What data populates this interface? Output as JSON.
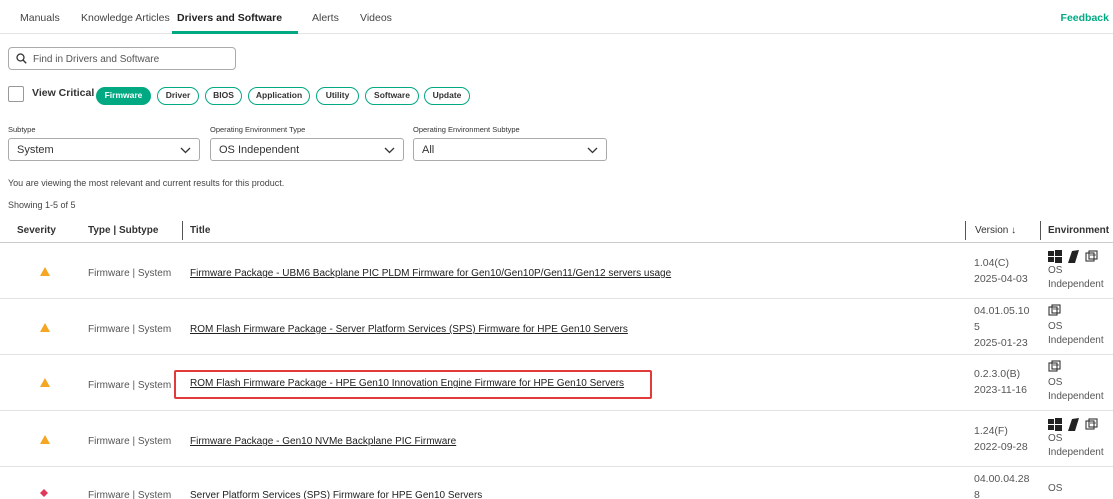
{
  "tabs": [
    {
      "label": "Manuals"
    },
    {
      "label": "Knowledge Articles"
    },
    {
      "label": "Drivers and Software",
      "active": true
    },
    {
      "label": "Alerts"
    },
    {
      "label": "Videos"
    }
  ],
  "feedback_label": "Feedback",
  "search": {
    "placeholder": "Find in Drivers and Software",
    "value": ""
  },
  "view_critical_label": "View Critical",
  "view_critical_checked": false,
  "chips": [
    {
      "label": "Firmware",
      "active": true
    },
    {
      "label": "Driver"
    },
    {
      "label": "BIOS"
    },
    {
      "label": "Application"
    },
    {
      "label": "Utility"
    },
    {
      "label": "Software"
    },
    {
      "label": "Update"
    }
  ],
  "filters": {
    "subtype": {
      "label": "Subtype",
      "value": "System"
    },
    "os_type": {
      "label": "Operating Environment Type",
      "value": "OS Independent"
    },
    "os_subtype": {
      "label": "Operating Environment Subtype",
      "value": "All"
    }
  },
  "info_text": "You are viewing the most relevant and current results for this product.",
  "showing_text": "Showing 1-5 of 5",
  "columns": {
    "severity": "Severity",
    "type": "Type | Subtype",
    "title": "Title",
    "version": "Version ↓",
    "environment": "Environment"
  },
  "rows": [
    {
      "severity": "recommended",
      "type": "Firmware | System",
      "title": "Firmware Package - UBM6 Backplane PIC PLDM Firmware for Gen10/Gen10P/Gen11/Gen12 servers usage",
      "version_lines": [
        "1.04(C)",
        "2025-04-03"
      ],
      "env_icons": [
        "windows-icon",
        "vmware-icon",
        "os-independent-icon"
      ],
      "env_lines": [
        "OS",
        "Independent"
      ]
    },
    {
      "severity": "recommended",
      "type": "Firmware | System",
      "title": "ROM Flash Firmware Package - Server Platform Services (SPS) Firmware for HPE Gen10 Servers",
      "version_lines": [
        "04.01.05.10",
        "5",
        "2025-01-23"
      ],
      "env_icons": [
        "os-independent-icon"
      ],
      "env_lines": [
        "OS",
        "Independent"
      ]
    },
    {
      "severity": "recommended",
      "type": "Firmware | System",
      "title": "ROM Flash Firmware Package - HPE Gen10 Innovation Engine Firmware for HPE Gen10 Servers",
      "version_lines": [
        "0.2.3.0(B)",
        "2023-11-16"
      ],
      "env_icons": [
        "os-independent-icon"
      ],
      "env_lines": [
        "OS",
        "Independent"
      ],
      "highlighted": true
    },
    {
      "severity": "recommended",
      "type": "Firmware | System",
      "title": "Firmware Package - Gen10 NVMe Backplane PIC Firmware",
      "version_lines": [
        "1.24(F)",
        "2022-09-28"
      ],
      "env_icons": [
        "windows-icon",
        "vmware-icon",
        "os-independent-icon"
      ],
      "env_lines": [
        "OS",
        "Independent"
      ]
    },
    {
      "severity": "critical",
      "type": "Firmware | System",
      "title": "Server Platform Services (SPS) Firmware for HPE Gen10 Servers",
      "version_lines": [
        "04.00.04.28",
        "8"
      ],
      "env_icons": [],
      "env_lines": [
        "OS"
      ]
    }
  ],
  "colors": {
    "accent": "#01a982",
    "recommended": "#f5a623",
    "critical": "#e0385b",
    "highlight": "#e03a3a"
  }
}
